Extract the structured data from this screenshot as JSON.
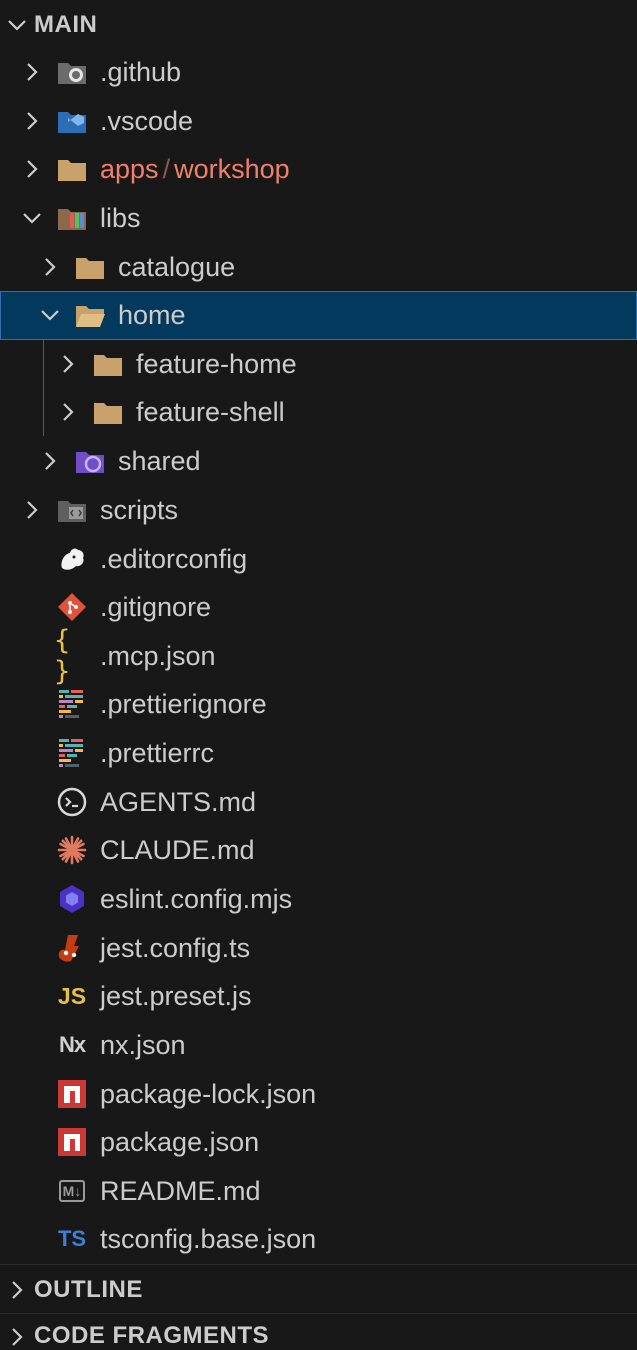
{
  "explorer": {
    "header": "MAIN",
    "tree": {
      "github": ".github",
      "vscode": ".vscode",
      "apps_part1": "apps",
      "apps_sep": "/",
      "apps_part2": "workshop",
      "libs": "libs",
      "catalogue": "catalogue",
      "home": "home",
      "feature_home": "feature-home",
      "feature_shell": "feature-shell",
      "shared": "shared",
      "scripts": "scripts",
      "editorconfig": ".editorconfig",
      "gitignore": ".gitignore",
      "mcp_json": ".mcp.json",
      "prettierignore": ".prettierignore",
      "prettierrc": ".prettierrc",
      "agents_md": "AGENTS.md",
      "claude_md": "CLAUDE.md",
      "eslint_config": "eslint.config.mjs",
      "jest_config": "jest.config.ts",
      "jest_preset": "jest.preset.js",
      "nx_json": "nx.json",
      "package_lock": "package-lock.json",
      "package_json": "package.json",
      "readme": "README.md",
      "tsconfig_base": "tsconfig.base.json"
    }
  },
  "icons": {
    "mcp_braces": "{ }",
    "js_badge": "JS",
    "ts_badge": "TS",
    "nx_badge": "Nx",
    "md_badge": "M↓"
  },
  "sections": {
    "outline": "OUTLINE",
    "code_fragments": "CODE FRAGMENTS"
  },
  "colors": {
    "background": "#181818",
    "selected_background": "#04395e",
    "selected_border": "#2f6fb0",
    "git_added": "#f0806b",
    "folder": "#c9a26b",
    "text": "#cccccc"
  }
}
